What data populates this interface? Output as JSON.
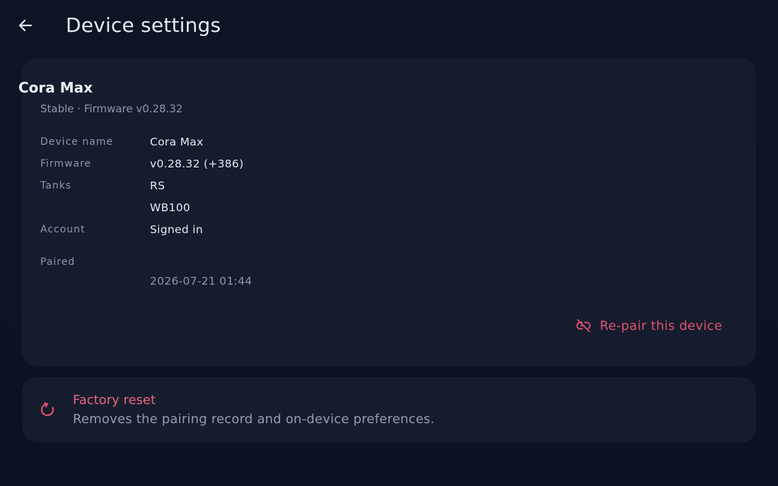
{
  "header": {
    "title": "Device settings",
    "back_icon": "arrow-left-icon"
  },
  "device": {
    "name": "Cora Max",
    "subtitle": "Stable · Firmware v0.28.32",
    "details": {
      "device_name_label": "Device name",
      "device_name_value": "Cora Max",
      "firmware_label": "Firmware",
      "firmware_value": "v0.28.32 (+386)",
      "tanks_label": "Tanks",
      "tanks_values": [
        "RS",
        "WB100"
      ],
      "account_label": "Account",
      "account_value": "Signed in",
      "paired_label": "Paired",
      "paired_value": "2026-07-21 01:44"
    },
    "repair_label": "Re-pair this device",
    "repair_icon": "link-off-icon"
  },
  "reset": {
    "title": "Factory reset",
    "description": "Removes the pairing record and on-device preferences.",
    "icon": "refresh-icon"
  },
  "colors": {
    "background": "#0d1321",
    "card": "#151c2d",
    "danger": "#e0506e",
    "muted_text": "#8f98ab"
  }
}
